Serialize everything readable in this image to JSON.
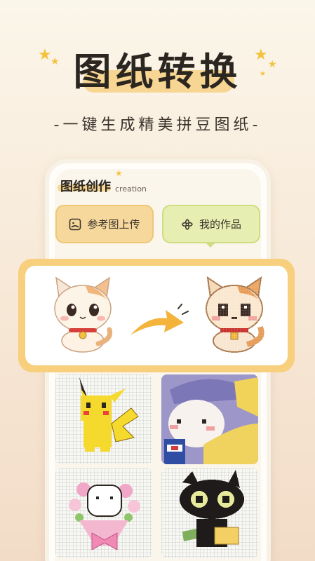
{
  "hero": {
    "title": "图纸转换",
    "subtitle": "-一键生成精美拼豆图纸-"
  },
  "section": {
    "title": "图纸创作",
    "subtitle": "creation"
  },
  "buttons": {
    "upload_label": "参考图上传",
    "works_label": "我的作品"
  },
  "colors": {
    "accent_yellow": "#f7d693",
    "upload_bg": "#f7d89c",
    "works_bg": "#e6efb1",
    "card_frame": "#f7cf7d"
  },
  "icons": {
    "upload": "image-icon",
    "works": "flower-icon",
    "convert": "arrow-right-icon",
    "decor": "star-icon"
  }
}
